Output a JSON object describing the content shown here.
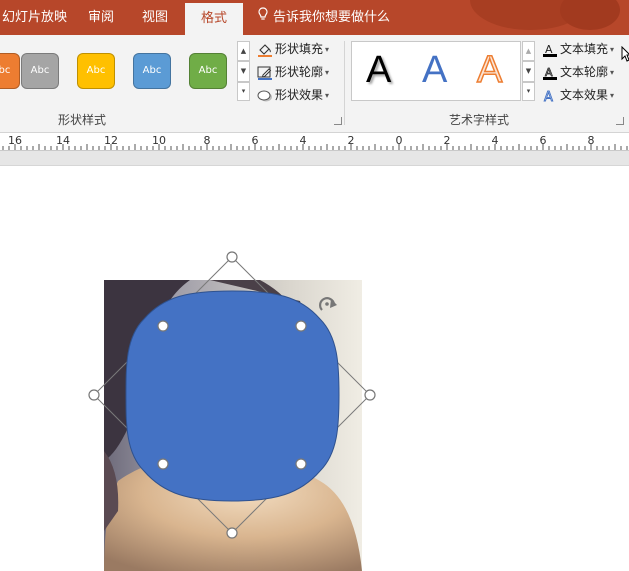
{
  "tabs": [
    {
      "label": "幻灯片放映"
    },
    {
      "label": "审阅"
    },
    {
      "label": "视图"
    },
    {
      "label": "格式",
      "active": true
    }
  ],
  "tell_me": "告诉我你想要做什么",
  "shape_styles": {
    "presets": [
      {
        "label": "Abc",
        "color": "#ed7d31"
      },
      {
        "label": "Abc",
        "color": "#a5a5a5"
      },
      {
        "label": "Abc",
        "color": "#ffc000"
      },
      {
        "label": "Abc",
        "color": "#5b9bd5"
      },
      {
        "label": "Abc",
        "color": "#70ad47"
      }
    ],
    "commands": {
      "fill": "形状填充",
      "outline": "形状轮廓",
      "effects": "形状效果"
    },
    "group_label": "形状样式"
  },
  "wordart_styles": {
    "presets": [
      {
        "label": "A",
        "style": "black-shadow"
      },
      {
        "label": "A",
        "style": "blue"
      },
      {
        "label": "A",
        "style": "orange-outline"
      }
    ],
    "commands": {
      "fill": "文本填充",
      "outline": "文本轮廓",
      "effects": "文本效果"
    },
    "group_label": "艺术字样式"
  },
  "ruler": {
    "labels": [
      "16",
      "14",
      "12",
      "10",
      "8",
      "6",
      "4",
      "2",
      "0",
      "2",
      "4",
      "6",
      "8"
    ]
  },
  "colors": {
    "accent": "#b7472a",
    "shape_fill": "#4472c4"
  }
}
